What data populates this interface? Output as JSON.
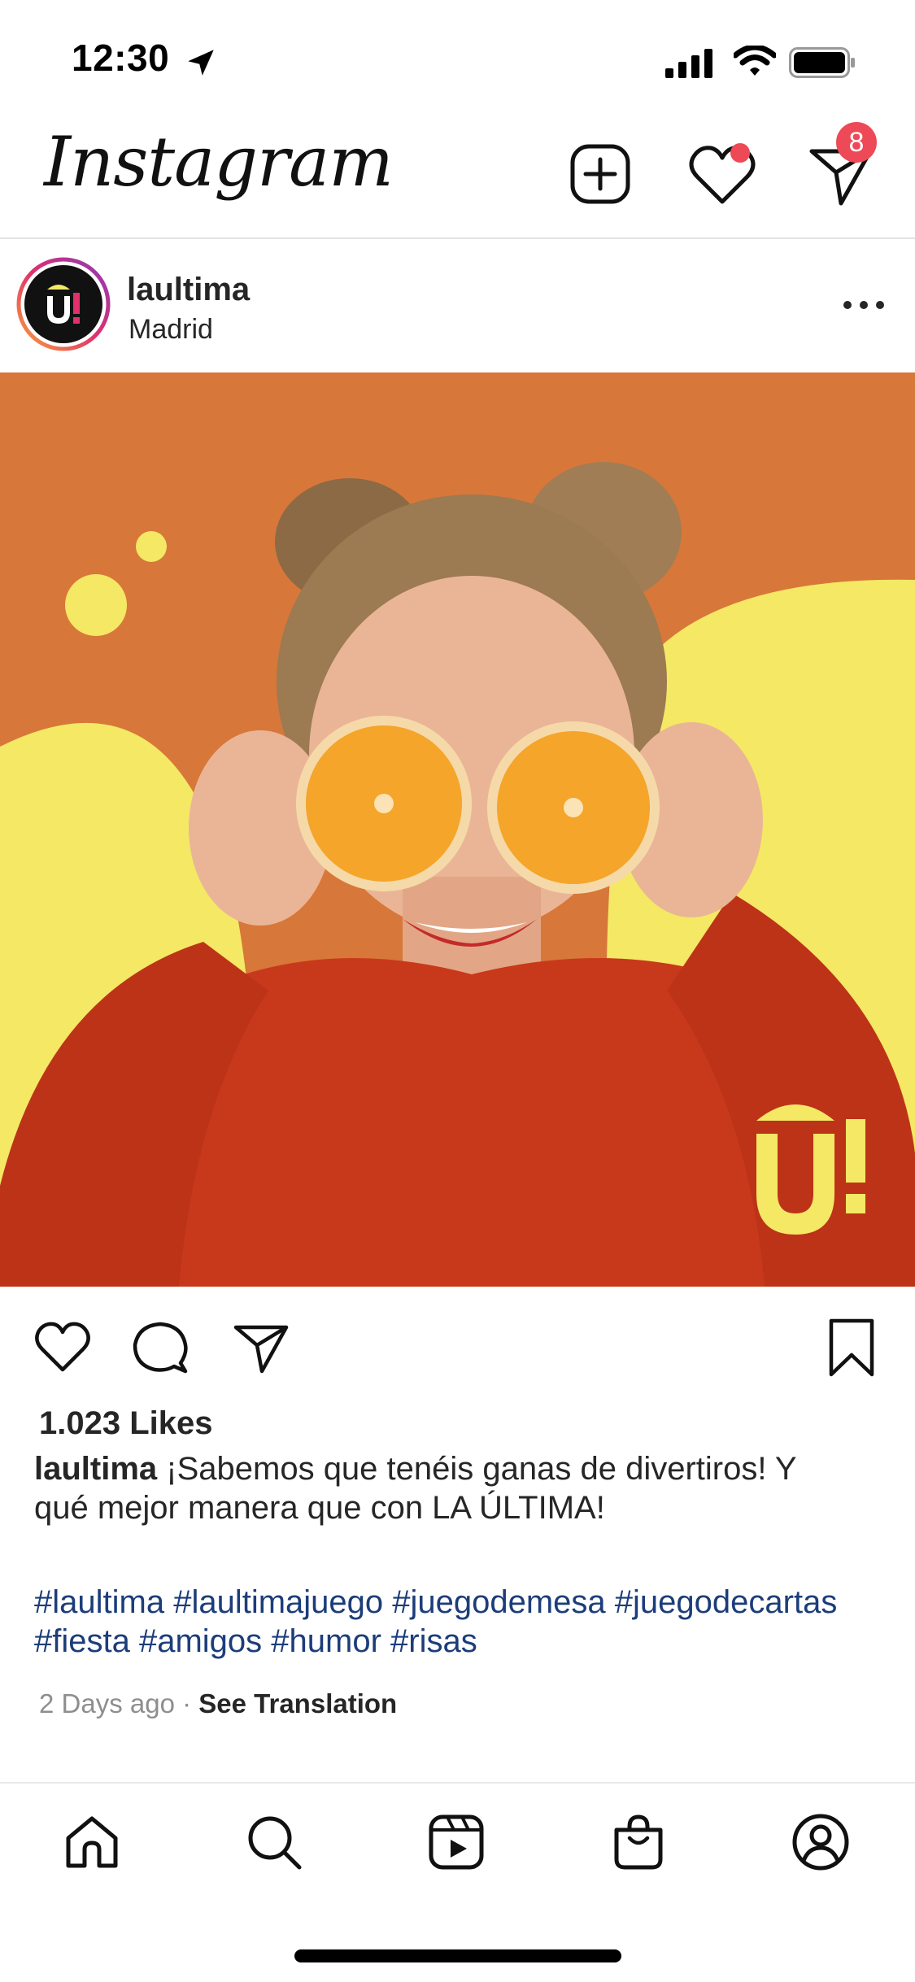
{
  "status_bar": {
    "time": "12:30"
  },
  "header": {
    "logo": "Instagram",
    "direct_badge_count": "8"
  },
  "post": {
    "username": "laultima",
    "location": "Madrid",
    "likes": "1.023 Likes",
    "caption_user": "laultima",
    "caption_text": " ¡Sabemos que tenéis ganas de divertiros! Y qué mejor manera que con LA ÚLTIMA!",
    "hashtags": "#laultima #laultimajuego #juegodemesa #juegodecartas #fiesta #amigos #humor #risas",
    "time_ago": "2 Days ago",
    "separator": " · ",
    "translate_label": "See Translation"
  },
  "tabs": [
    {
      "icon": "home-icon"
    },
    {
      "icon": "search-icon"
    },
    {
      "icon": "reels-icon"
    },
    {
      "icon": "shop-icon"
    },
    {
      "icon": "profile-icon"
    }
  ],
  "colors": {
    "badge": "#ed4956",
    "hashtag": "#1c3d7a",
    "image_background": "#d8773a",
    "accent_yellow": "#f4e865",
    "sweater": "#c8391c"
  }
}
